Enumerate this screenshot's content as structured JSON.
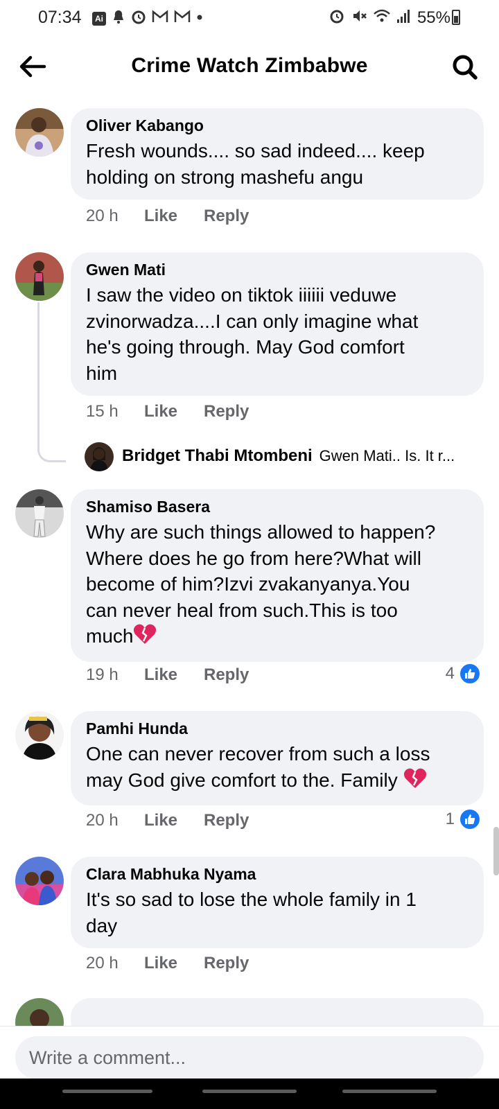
{
  "status_bar": {
    "time": "07:34",
    "ai_badge": "Ai",
    "battery": "55%",
    "left_icons": [
      "ai-icon",
      "notification-icon",
      "alarm-icon",
      "gmail-icon",
      "gmail-icon",
      "dot-icon"
    ],
    "right_icons": [
      "alarm-icon",
      "mute-vibrate-icon",
      "wifi-icon",
      "signal-icon",
      "battery-icon"
    ]
  },
  "header": {
    "title": "Crime Watch Zimbabwe",
    "back_icon": "arrow-left-icon",
    "search_icon": "search-icon"
  },
  "comments": [
    {
      "author": "Oliver Kabango",
      "lines": [
        "Fresh wounds.... so sad indeed.... keep",
        "holding on strong mashefu angu"
      ],
      "time": "20 h",
      "like": "Like",
      "reply": "Reply"
    },
    {
      "author": "Gwen Mati",
      "lines": [
        "I saw the video on tiktok iiiiii veduwe",
        "zvinorwadza....I can only imagine what",
        "he's going through. May God comfort",
        "him"
      ],
      "time": "15 h",
      "like": "Like",
      "reply": "Reply",
      "reply_preview": {
        "author": "Bridget Thabi Mtombeni",
        "text": "Gwen Mati.. Is. It r..."
      }
    },
    {
      "author": "Shamiso Basera",
      "lines": [
        "Why are such things allowed to happen?",
        "Where does he go from here?What will",
        "become of him?Izvi zvakanyanya.You",
        "can never heal from such.This is too",
        "much"
      ],
      "time": "19 h",
      "like": "Like",
      "reply": "Reply",
      "reaction_count": "4"
    },
    {
      "author": "Pamhi Hunda",
      "lines": [
        "One can never recover from such a loss",
        "may God give comfort to the. Family"
      ],
      "time": "20 h",
      "like": "Like",
      "reply": "Reply",
      "reaction_count": "1"
    },
    {
      "author": "Clara Mabhuka Nyama",
      "lines": [
        "It's so sad to lose the whole family in 1",
        "day"
      ],
      "time": "20 h",
      "like": "Like",
      "reply": "Reply"
    }
  ],
  "composer": {
    "placeholder": "Write a comment..."
  },
  "colors": {
    "bubble": "#f0f2f5",
    "meta_text": "#65676b",
    "like_blue": "#1877f2",
    "broken_heart": "#e0245e"
  }
}
